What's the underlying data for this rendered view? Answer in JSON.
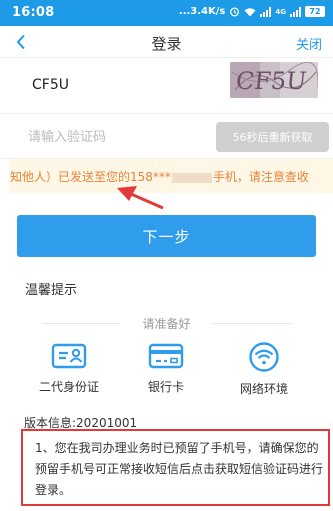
{
  "status_bar": {
    "time": "16:08",
    "network_speed": "...3.4K/s",
    "battery_level": "72",
    "network_type_icon": "4G"
  },
  "nav": {
    "title": "登录",
    "back_icon": "chevron-left-icon",
    "close_label": "关闭"
  },
  "captcha": {
    "value": "CF5U",
    "image_text": "CF5U"
  },
  "sms": {
    "placeholder": "请输入验证码",
    "resend_label": "56秒后重新获取"
  },
  "notice": {
    "text_before": "知他人）已发送至您的158***",
    "text_after": "手机，请注意查收"
  },
  "next_button_label": "下一步",
  "tips_title": "温馨提示",
  "prepare": {
    "title": "请准备好",
    "items": [
      {
        "label": "二代身份证",
        "icon": "id-card-icon"
      },
      {
        "label": "银行卡",
        "icon": "bank-card-icon"
      },
      {
        "label": "网络环境",
        "icon": "wifi-icon"
      }
    ]
  },
  "version": "版本信息:20201001",
  "tip_text": "1、您在我司办理业务时已预留了手机号，请确保您的预留手机号可正常接收短信后点击获取短信验证码进行登录。",
  "colors": {
    "primary": "#2f9cec",
    "status_bar": "#1e9be6",
    "notice_text": "#e8833a",
    "notice_bg": "#fff7e6",
    "highlight_border": "#e23a3a",
    "arrow": "#e23a3a"
  }
}
